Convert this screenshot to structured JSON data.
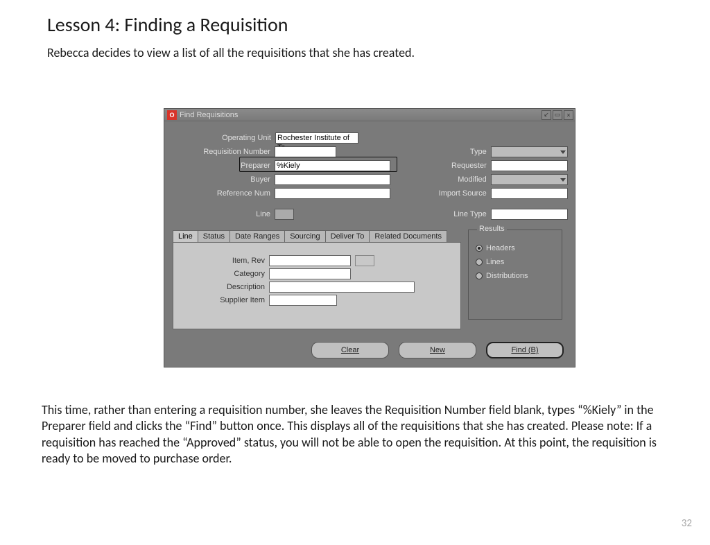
{
  "page": {
    "title": "Lesson 4:  Finding a Requisition",
    "intro": "Rebecca decides to view a list of all the requisitions that she has created.",
    "body": "This time, rather than entering a requisition number, she leaves the Requisition Number field blank, types “%Kiely” in the Preparer field and clicks the “Find” button once.  This displays all of the requisitions that she has created.   Please note:  If a requisition has reached the “Approved” status, you will not be able to open the requisition.  At this point, the requisition is ready to be moved to purchase order.",
    "number": "32"
  },
  "window": {
    "title": "Find Requisitions",
    "fields": {
      "operating_unit": {
        "label": "Operating Unit",
        "value": "Rochester Institute of Te"
      },
      "requisition_number": {
        "label": "Requisition Number",
        "value": ""
      },
      "preparer": {
        "label": "Preparer",
        "value": "%Kiely"
      },
      "buyer": {
        "label": "Buyer",
        "value": ""
      },
      "reference_num": {
        "label": "Reference Num",
        "value": ""
      },
      "type": {
        "label": "Type"
      },
      "requester": {
        "label": "Requester",
        "value": ""
      },
      "modified": {
        "label": "Modified"
      },
      "import_source": {
        "label": "Import Source",
        "value": ""
      },
      "line": {
        "label": "Line",
        "value": ""
      },
      "line_type": {
        "label": "Line Type",
        "value": ""
      }
    },
    "tabs": [
      "Line",
      "Status",
      "Date Ranges",
      "Sourcing",
      "Deliver To",
      "Related Documents"
    ],
    "tab_line": {
      "item_rev": {
        "label": "Item, Rev",
        "value": ""
      },
      "category": {
        "label": "Category",
        "value": ""
      },
      "description": {
        "label": "Description",
        "value": ""
      },
      "supplier_item": {
        "label": "Supplier Item",
        "value": ""
      }
    },
    "results": {
      "title": "Results",
      "options": [
        "Headers",
        "Lines",
        "Distributions"
      ],
      "selected": "Headers"
    },
    "buttons": {
      "clear": "Clear",
      "new": "New",
      "find": "Find (B)"
    }
  }
}
